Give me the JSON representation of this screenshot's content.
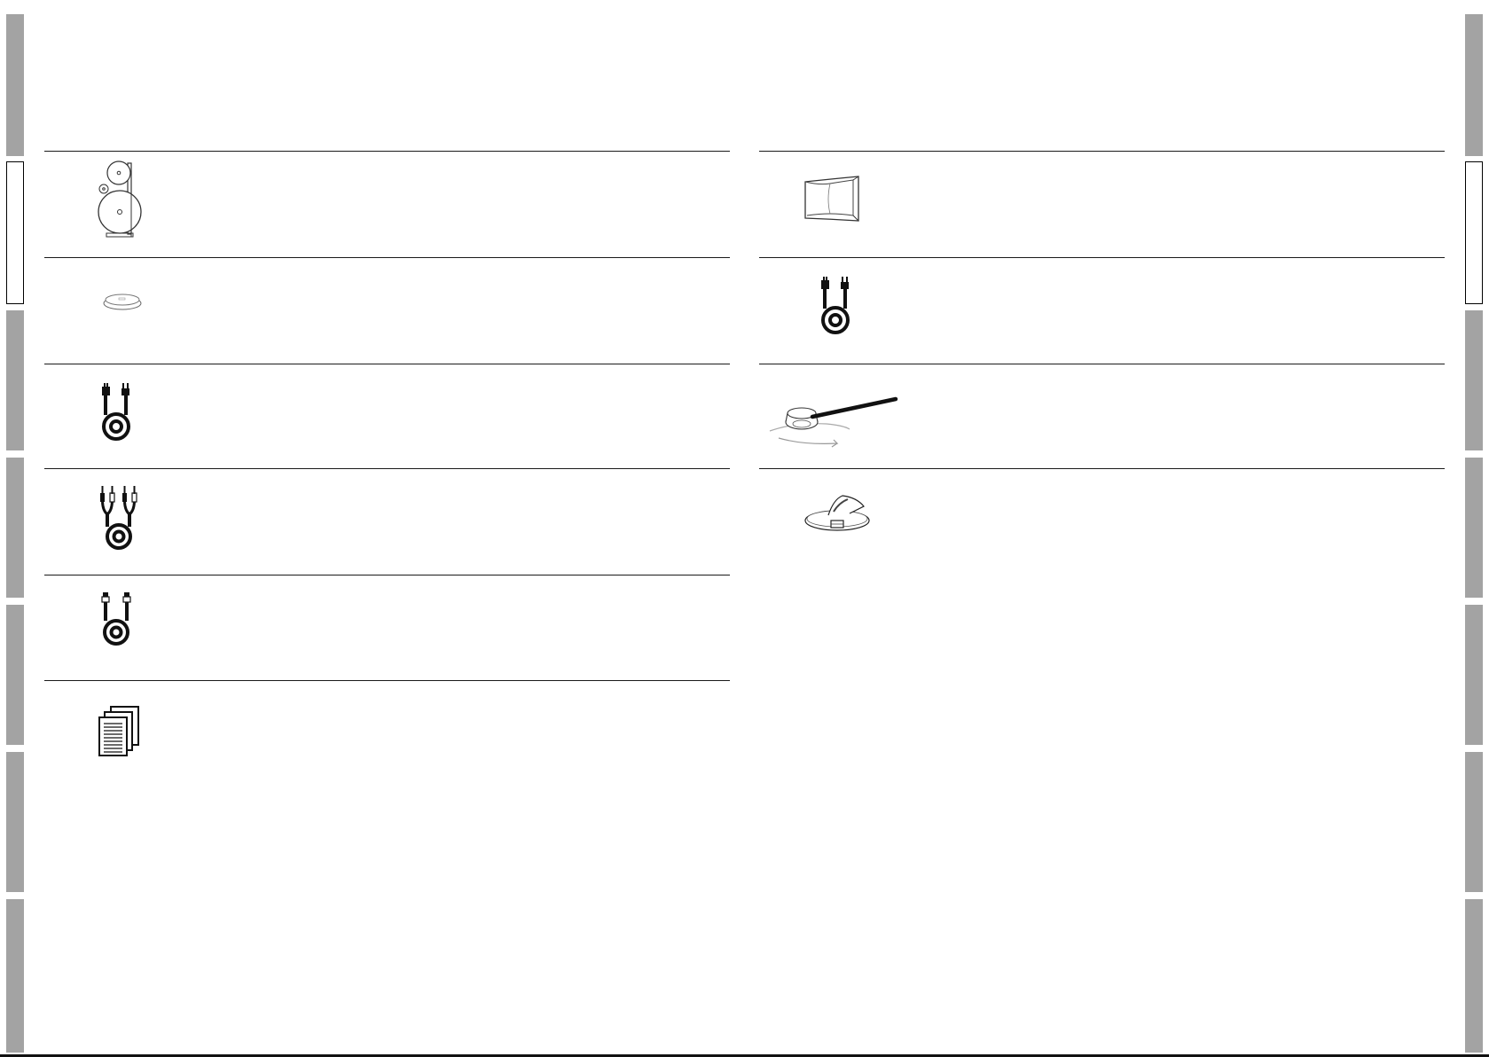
{
  "page": {
    "title": "",
    "background": "#ffffff",
    "tab_color": "#a3a3a3",
    "rule_color": "#1a1a1a"
  },
  "left_tabs": [
    {
      "state": "inactive"
    },
    {
      "state": "active"
    },
    {
      "state": "inactive"
    },
    {
      "state": "inactive"
    },
    {
      "state": "inactive"
    },
    {
      "state": "inactive"
    },
    {
      "state": "inactive"
    }
  ],
  "right_tabs": [
    {
      "state": "inactive"
    },
    {
      "state": "active"
    },
    {
      "state": "inactive"
    },
    {
      "state": "inactive"
    },
    {
      "state": "inactive"
    },
    {
      "state": "inactive"
    },
    {
      "state": "inactive"
    }
  ],
  "left_column": {
    "items": [
      {
        "icon": "speaker-reel-icon",
        "label": ""
      },
      {
        "icon": "remote-puck-icon",
        "label": ""
      },
      {
        "icon": "power-cord-icon",
        "label": ""
      },
      {
        "icon": "rca-cable-icon",
        "label": ""
      },
      {
        "icon": "coax-cable-icon",
        "label": ""
      },
      {
        "icon": "manuals-icon",
        "label": ""
      }
    ]
  },
  "right_column": {
    "items": [
      {
        "icon": "bracket-cover-icon",
        "label": ""
      },
      {
        "icon": "power-cord-icon",
        "label": ""
      },
      {
        "icon": "ceiling-mount-tool-icon",
        "label": ""
      },
      {
        "icon": "base-stand-icon",
        "label": ""
      }
    ]
  }
}
